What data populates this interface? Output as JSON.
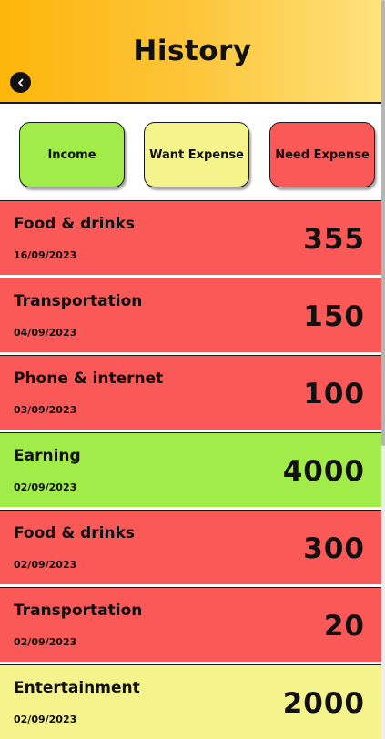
{
  "header": {
    "title": "History",
    "back_icon": "chevron-left-icon"
  },
  "filters": [
    {
      "label": "Income",
      "color": "#a1ec49"
    },
    {
      "label": "Want Expense",
      "color": "#f5f38c"
    },
    {
      "label": "Need Expense",
      "color": "#fb5858"
    }
  ],
  "transactions": [
    {
      "title": "Food & drinks",
      "date": "16/09/2023",
      "amount": "355",
      "category": "need"
    },
    {
      "title": "Transportation",
      "date": "04/09/2023",
      "amount": "150",
      "category": "need"
    },
    {
      "title": "Phone & internet",
      "date": "03/09/2023",
      "amount": "100",
      "category": "need"
    },
    {
      "title": "Earning",
      "date": "02/09/2023",
      "amount": "4000",
      "category": "income"
    },
    {
      "title": "Food & drinks",
      "date": "02/09/2023",
      "amount": "300",
      "category": "need"
    },
    {
      "title": "Transportation",
      "date": "02/09/2023",
      "amount": "20",
      "category": "need"
    },
    {
      "title": "Entertainment",
      "date": "02/09/2023",
      "amount": "2000",
      "category": "want"
    }
  ],
  "colors": {
    "header_start": "#fdb60a",
    "header_end": "#fde37e",
    "income": "#a1ec49",
    "want": "#f5f38c",
    "need": "#fb5858"
  }
}
